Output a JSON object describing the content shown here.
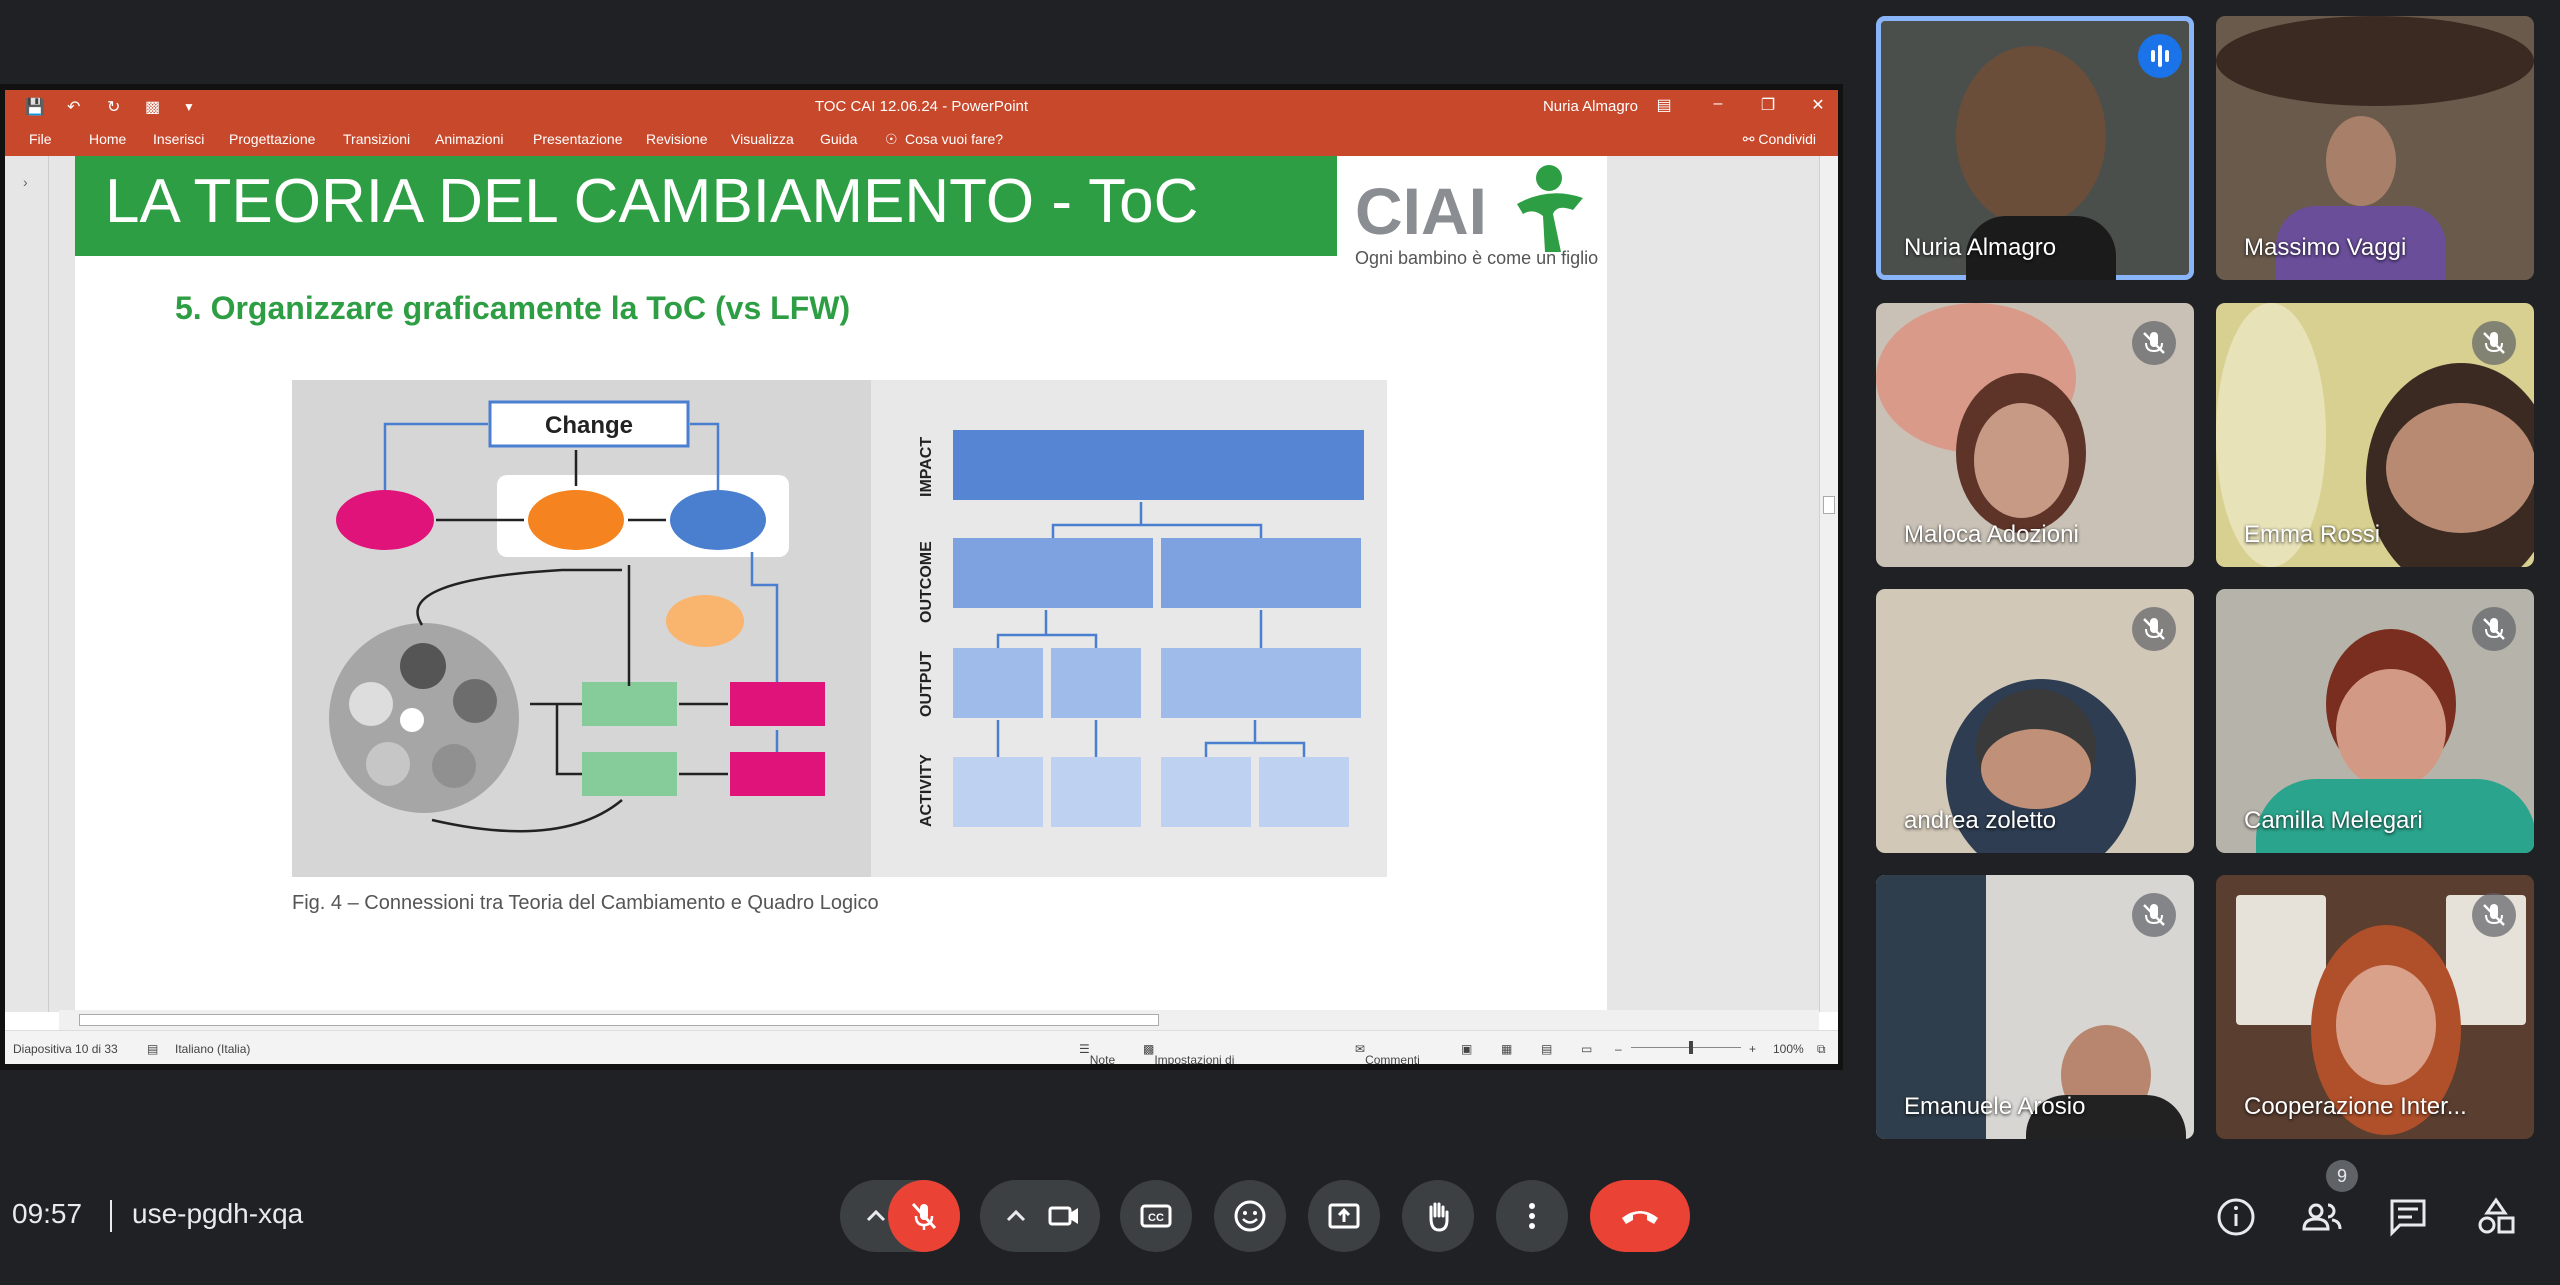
{
  "presentation": {
    "window_title": "TOC CAI 12.06.24  -  PowerPoint",
    "user_name": "Nuria Almagro",
    "ribbon_menus": [
      "File",
      "Home",
      "Inserisci",
      "Progettazione",
      "Transizioni",
      "Animazioni",
      "Presentazione",
      "Revisione",
      "Visualizza",
      "Guida"
    ],
    "tell_me": "Cosa vuoi fare?",
    "share_label": "Condividi",
    "status": {
      "slide_counter": "Diapositiva 10 di 33",
      "language": "Italiano (Italia)",
      "notes": "Note",
      "view_settings": "Impostazioni di visualizzazione",
      "comments": "Commenti",
      "zoom": "100%"
    },
    "slide": {
      "heading": "LA TEORIA DEL CAMBIAMENTO - ToC",
      "logo_text": "CIAI",
      "logo_tagline": "Ogni bambino è come un figlio",
      "subtitle": "5. Organizzare graficamente la ToC (vs LFW)",
      "diagram_change_label": "Change",
      "lfw_levels": [
        "IMPACT",
        "OUTCOME",
        "OUTPUT",
        "ACTIVITY"
      ],
      "caption": "Fig. 4 – Connessioni tra Teoria del Cambiamento e Quadro Logico"
    }
  },
  "participants": [
    {
      "name": "Nuria Almagro",
      "speaking": true
    },
    {
      "name": "Massimo Vaggi",
      "muted": false
    },
    {
      "name": "Maloca Adozioni",
      "muted": true
    },
    {
      "name": "Emma Rossi",
      "muted": true
    },
    {
      "name": "andrea zoletto",
      "muted": true
    },
    {
      "name": "Camilla Melegari",
      "muted": true
    },
    {
      "name": "Emanuele Arosio",
      "muted": true
    },
    {
      "name": "Cooperazione Inter...",
      "muted": true
    }
  ],
  "meeting": {
    "time": "09:57",
    "code": "use-pgdh-xqa",
    "participant_count": "9"
  },
  "colors": {
    "background": "#202124",
    "ppt_ribbon": "#c8482b",
    "slide_green": "#2e9e44",
    "end_call": "#ea4335",
    "mic_off": "#ea4335",
    "active_speaker": "#1a73e8"
  }
}
